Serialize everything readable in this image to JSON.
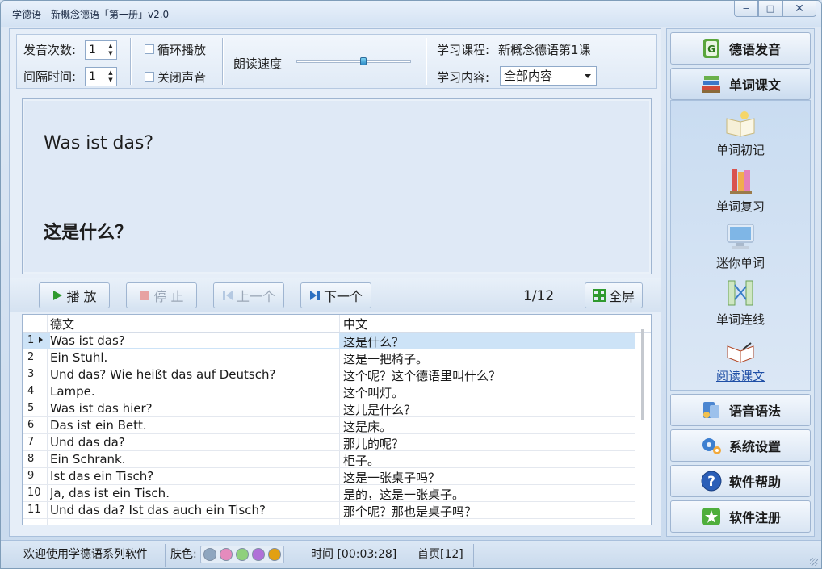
{
  "window": {
    "title": "学德语—新概念德语「第一册」v2.0",
    "minimize": "−",
    "maximize": "□",
    "close": "✕"
  },
  "controls": {
    "repeat_label": "发音次数:",
    "repeat_value": "1",
    "interval_label": "间隔时间:",
    "interval_value": "1",
    "loop_label": "循环播放",
    "mute_label": "关闭声音",
    "speed_label": "朗读速度",
    "speed_level": 0.58,
    "course_label": "学习课程:",
    "course_value": "新概念德语第1课",
    "content_label": "学习内容:",
    "content_value": "全部内容"
  },
  "display": {
    "german": "Was ist das?",
    "chinese": "这是什么？"
  },
  "toolbar": {
    "play": "播 放",
    "stop": "停 止",
    "prev": "上一个",
    "next": "下一个",
    "counter": "1/12",
    "fullscreen": "全屏"
  },
  "table": {
    "headers": [
      "德文",
      "中文"
    ],
    "rows": [
      {
        "n": "1",
        "de": "Was ist das?",
        "zh": "这是什么？"
      },
      {
        "n": "2",
        "de": "Ein Stuhl.",
        "zh": "这是一把椅子。"
      },
      {
        "n": "3",
        "de": "Und das? Wie heißt das auf Deutsch?",
        "zh": "这个呢？这个德语里叫什么？"
      },
      {
        "n": "4",
        "de": "Lampe.",
        "zh": "这个叫灯。"
      },
      {
        "n": "5",
        "de": "Was ist das hier?",
        "zh": "这儿是什么？"
      },
      {
        "n": "6",
        "de": "Das ist ein Bett.",
        "zh": "这是床。"
      },
      {
        "n": "7",
        "de": "Und das da?",
        "zh": "那儿的呢？"
      },
      {
        "n": "8",
        "de": "Ein Schrank.",
        "zh": "柜子。"
      },
      {
        "n": "9",
        "de": "Ist das ein Tisch?",
        "zh": "这是一张桌子吗？"
      },
      {
        "n": "10",
        "de": "Ja, das ist ein Tisch.",
        "zh": "是的，这是一张桌子。"
      },
      {
        "n": "11",
        "de": "Und das da? Ist das auch ein Tisch?",
        "zh": "那个呢？那也是桌子吗？"
      }
    ]
  },
  "nav": {
    "pronunciation": "德语发音",
    "words_text": "单词课文",
    "sub": {
      "word_first": "单词初记",
      "word_review": "单词复习",
      "mini_words": "迷你单词",
      "word_match": "单词连线",
      "read_text": "阅读课文"
    },
    "grammar": "语音语法",
    "settings": "系统设置",
    "help": "软件帮助",
    "register": "软件注册"
  },
  "status": {
    "welcome": "欢迎使用学德语系列软件",
    "skin_label": "肤色:",
    "skins": [
      "#8fa6bf",
      "#e58bbd",
      "#8fd07c",
      "#b06fd8",
      "#e2a012"
    ],
    "time": "时间 [00:03:28]",
    "page": "首页[12]"
  },
  "colors": {
    "accent": "#1f4fa6",
    "selected_row": "#cde3f7"
  }
}
